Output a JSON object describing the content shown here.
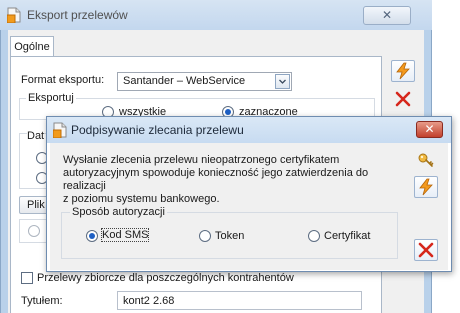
{
  "back_window": {
    "title": "Eksport przelewów",
    "close_glyph": "✕",
    "tab_general": "Ogólne",
    "format_label": "Format eksportu:",
    "format_value": "Santander – WebService",
    "export_group_label": "Eksportuj",
    "radio_all": "wszystkie",
    "radio_selected": "zaznaczone",
    "partial_date_label": "Dat",
    "partial_file_label": "Plik",
    "bulk_transfer_label": "Przelewy zbiorcze dla poszczególnych kontrahentów",
    "title_label": "Tytułem:",
    "title_value": "kont2 2.68"
  },
  "dialog": {
    "title": "Podpisywanie zlecania przelewu",
    "close_glyph": "✕",
    "message_line1": "Wysłanie zlecenia przelewu nieopatrzonego certyfikatem",
    "message_line2": "autoryzacyjnym spowoduje konieczność jego zatwierdzenia do realizacji",
    "message_line3": "z poziomu systemu bankowego.",
    "auth_group_label": "Sposób autoryzacji",
    "option_sms": "Kod SMS",
    "option_token": "Token",
    "option_cert": "Certyfikat"
  },
  "icons": {
    "export": "lightning-icon",
    "cancel": "red-x-icon",
    "key": "key-icon"
  },
  "colors": {
    "accent_blue": "#1d5fc4",
    "close_red": "#c2402c",
    "cancel_red": "#d6261b",
    "lightning_orange": "#f39a1e"
  }
}
